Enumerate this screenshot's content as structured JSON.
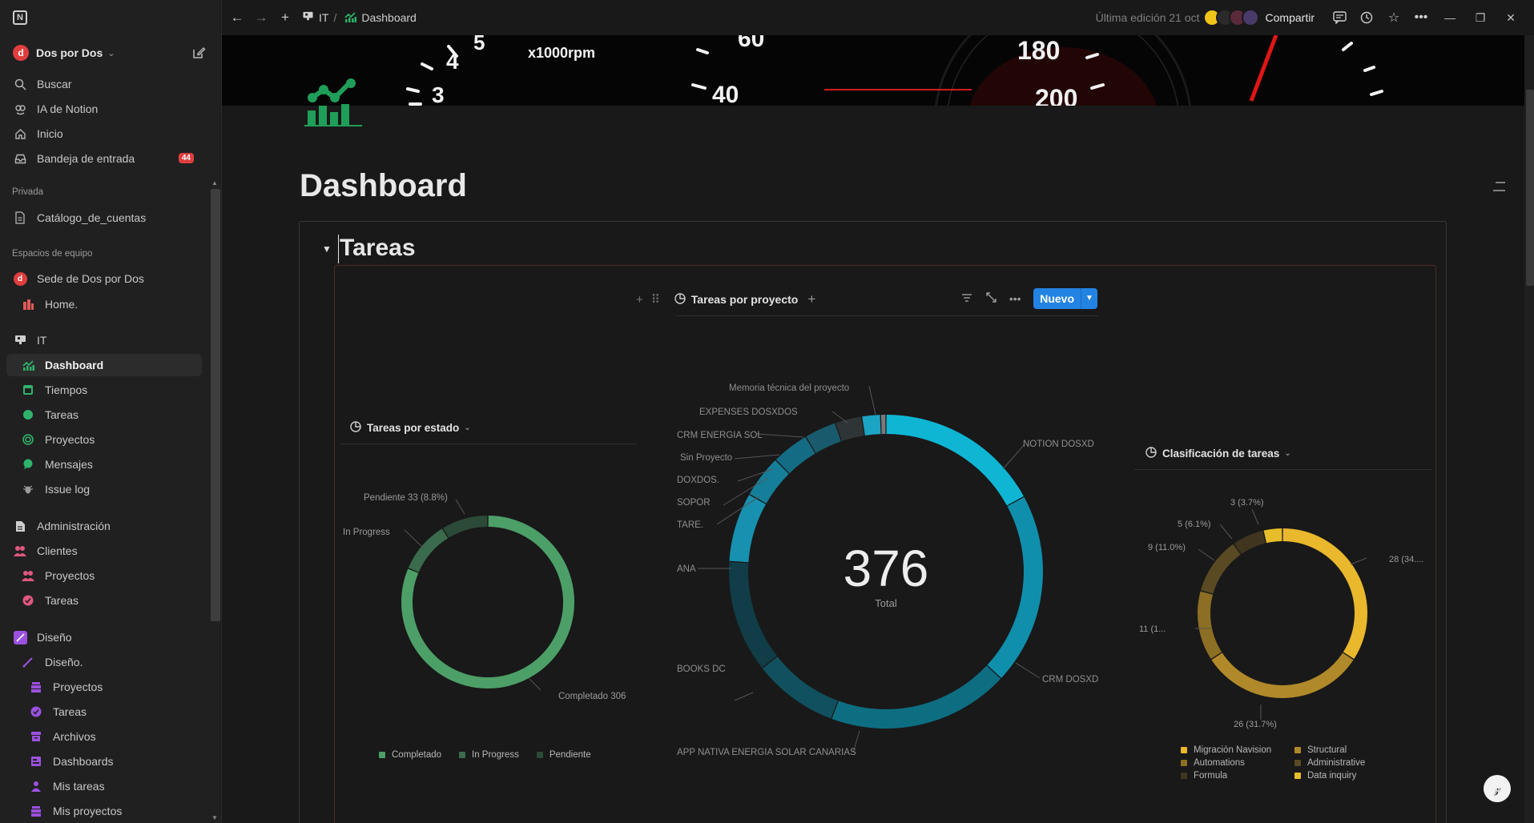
{
  "sidebar": {
    "workspace": "Dos por Dos",
    "top_items": [
      {
        "label": "Buscar",
        "icon": "search-icon"
      },
      {
        "label": "IA de Notion",
        "icon": "notion-ai-icon"
      },
      {
        "label": "Inicio",
        "icon": "home-icon"
      },
      {
        "label": "Bandeja de entrada",
        "icon": "inbox-icon",
        "badge": "44"
      }
    ],
    "private_label": "Privada",
    "private_items": [
      {
        "label": "Catálogo_de_cuentas",
        "icon": "page-icon"
      }
    ],
    "team_label": "Espacios de equipo",
    "team_items": [
      {
        "label": "Sede de Dos por Dos",
        "icon": "workspace-icon"
      },
      {
        "label": "Home.",
        "icon": "building-icon"
      },
      {
        "label": "IT",
        "icon": "it-icon"
      },
      {
        "label": "Dashboard",
        "icon": "chart-icon"
      },
      {
        "label": "Tiempos",
        "icon": "calendar-icon"
      },
      {
        "label": "Tareas",
        "icon": "circle-icon"
      },
      {
        "label": "Proyectos",
        "icon": "target-icon"
      },
      {
        "label": "Mensajes",
        "icon": "chat-icon"
      },
      {
        "label": "Issue log",
        "icon": "bug-icon"
      },
      {
        "label": "Administración",
        "icon": "document-icon"
      },
      {
        "label": "Clientes",
        "icon": "people-icon"
      },
      {
        "label": "Proyectos",
        "icon": "people-icon"
      },
      {
        "label": "Tareas",
        "icon": "check-icon"
      },
      {
        "label": "Diseño",
        "icon": "pen-icon"
      },
      {
        "label": "Diseño.",
        "icon": "pen-icon"
      },
      {
        "label": "Proyectos",
        "icon": "stack-icon"
      },
      {
        "label": "Tareas",
        "icon": "check-icon"
      },
      {
        "label": "Archivos",
        "icon": "archive-icon"
      },
      {
        "label": "Dashboards",
        "icon": "board-icon"
      },
      {
        "label": "Mis tareas",
        "icon": "person-icon"
      },
      {
        "label": "Mis proyectos",
        "icon": "stack-icon"
      }
    ]
  },
  "topbar": {
    "breadcrumb_parent": "IT",
    "breadcrumb_sep": "/",
    "breadcrumb_current": "Dashboard",
    "last_edited": "Última edición 21 oct",
    "share": "Compartir"
  },
  "cover": {
    "gauge_labels": [
      "5",
      "4",
      "3",
      "x1000rpm",
      "60",
      "40",
      "180",
      "200"
    ]
  },
  "page": {
    "title": "Dashboard",
    "section_heading": "Tareas"
  },
  "view_bar": {
    "tab_label": "Tareas por proyecto",
    "new_button": "Nuevo"
  },
  "widgets": {
    "estado": {
      "title": "Tareas por estado",
      "labels": {
        "pendiente": "Pendiente  33 (8.8%)",
        "in_progress": "In Progress",
        "completado": "Completado  306"
      }
    },
    "proyecto": {
      "total": "376",
      "total_label": "Total",
      "labels": [
        "Memoria técnica del proyecto",
        "EXPENSES DOSXDOS",
        "CRM ENERGIA SOL",
        "Sin Proyecto",
        "DOXDOS.",
        "SOPOR",
        "TARE.",
        "ANA",
        "BOOKS DC",
        "APP NATIVA ENERGIA SOLAR CANARIAS",
        "NOTION DOSXD",
        "CRM DOSXD"
      ]
    },
    "clasificacion": {
      "title": "Clasificación de tareas",
      "labels": {
        "l1": "3 (3.7%)",
        "l2": "5 (6.1%)",
        "l3": "9 (11.0%)",
        "l4": "11 (1...",
        "l5": "26 (31.7%)",
        "l6": "28 (34...."
      }
    }
  },
  "chart_data": [
    {
      "type": "pie",
      "title": "Tareas por estado",
      "categories": [
        "Completado",
        "In Progress",
        "Pendiente"
      ],
      "values": [
        306,
        37,
        33
      ],
      "colors": [
        "#4d9f68",
        "#3a6b4c",
        "#2c4a38"
      ],
      "legend": [
        "Completado",
        "In Progress",
        "Pendiente"
      ],
      "legend_position": "bottom"
    },
    {
      "type": "pie",
      "title": "Tareas por proyecto",
      "total": 376,
      "categories": [
        "NOTION DOSXD",
        "CRM DOSXD",
        "APP NATIVA ENERGIA SOLAR CANARIAS",
        "BOOKS DC",
        "ANA",
        "TARE.",
        "SOPOR",
        "DOXDOS.",
        "Sin Proyecto",
        "CRM ENERGIA SOL",
        "EXPENSES DOSXDOS",
        "Memoria técnica del proyecto"
      ],
      "values": [
        62,
        72,
        68,
        32,
        42,
        26,
        16,
        14,
        12,
        10,
        7,
        2
      ],
      "colors": [
        "#0fb6d4",
        "#0f8fab",
        "#0d6e82",
        "#11505e",
        "#103d47",
        "#1890b0",
        "#157f9a",
        "#136c84",
        "#195b6c",
        "#2f3537",
        "#1ca4c4",
        "#7a7a7a"
      ],
      "legend_position": "none"
    },
    {
      "type": "pie",
      "title": "Clasificación de tareas",
      "categories": [
        "Migración Navision",
        "Structural",
        "Automations",
        "Administrative",
        "Formula",
        "Data inquiry"
      ],
      "values": [
        28,
        26,
        11,
        9,
        5,
        3
      ],
      "percent_labels": [
        "34....",
        "31.7%",
        "1...",
        "11.0%",
        "6.1%",
        "3.7%"
      ],
      "colors": [
        "#e9b82c",
        "#b0892a",
        "#8c6e24",
        "#5a4a23",
        "#403620",
        "#e8bd2a"
      ],
      "legend": [
        "Migración Navision",
        "Structural",
        "Automations",
        "Administrative",
        "Formula",
        "Data inquiry"
      ],
      "legend_position": "bottom"
    }
  ]
}
